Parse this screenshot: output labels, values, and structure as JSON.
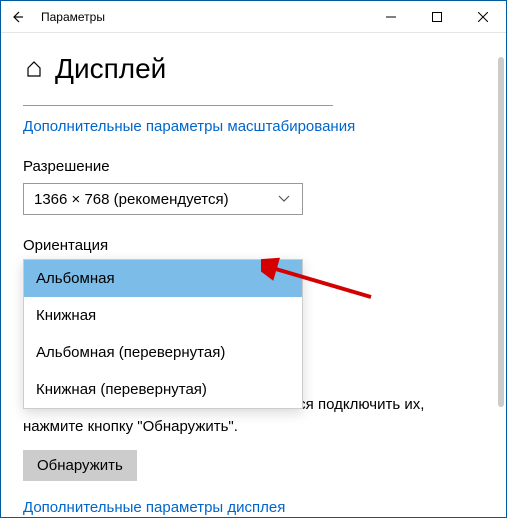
{
  "titlebar": {
    "title": "Параметры"
  },
  "page": {
    "heading": "Дисплей"
  },
  "links": {
    "scaling": "Дополнительные параметры масштабирования",
    "display": "Дополнительные параметры дисплея"
  },
  "resolution": {
    "label": "Разрешение",
    "value": "1366 × 768 (рекомендуется)"
  },
  "orientation": {
    "label": "Ориентация",
    "options": [
      "Альбомная",
      "Книжная",
      "Альбомная (перевернутая)",
      "Книжная (перевернутая)"
    ]
  },
  "detect": {
    "text_tail": "чаться автоматически. Чтобы попытаться подключить их, нажмите кнопку \"Обнаружить\".",
    "button": "Обнаружить"
  }
}
